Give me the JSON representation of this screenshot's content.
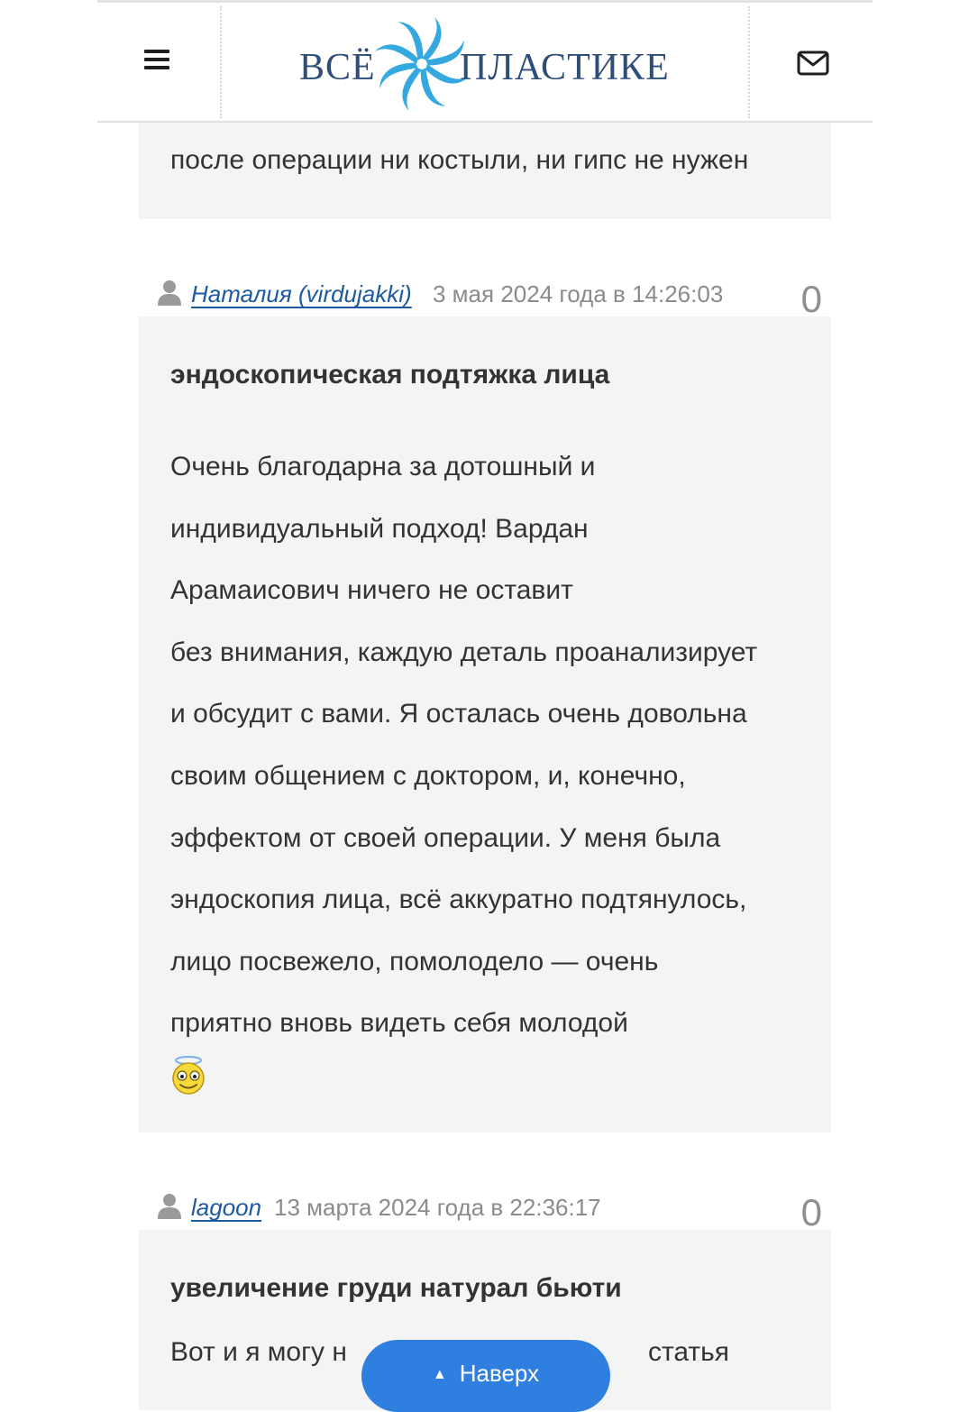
{
  "header": {
    "logo_left": "ВСЁ",
    "logo_right": "ПЛАСТИКЕ",
    "menu_icon": "hamburger-menu-icon",
    "mail_icon": "envelope-icon",
    "brand_color": "#2e4e78",
    "swirl_color": "#35a9df"
  },
  "top_card": {
    "text": "после операции ни костыли, ни гипс не нужен"
  },
  "comments": [
    {
      "author": "Наталия (virdujakki)",
      "date": "3 мая 2024 года в 14:26:03",
      "votes": "0",
      "title": "эндоскопическая подтяжка лица",
      "lines": [
        "Очень благодарна за дотошный и",
        "индивидуальный подход! Вардан",
        "Арамаисович ничего не оставит",
        "без внимания, каждую деталь проанализирует",
        "и обсудит с вами. Я осталась очень довольна",
        "своим общением с доктором, и, конечно,",
        "эффектом от своей операции. У меня была",
        "эндоскопия лица, всё аккуратно подтянулось,",
        "лицо посвежело, помолодело — очень",
        "приятно вновь видеть себя молодой"
      ],
      "emoji": "angel-smiley-icon"
    },
    {
      "author": "lagoon",
      "date": "13 марта 2024 года в 22:36:17",
      "votes": "0",
      "title": "увеличение груди натурал бьюти",
      "partial_left": "Вот и я могу н",
      "partial_right": "статья"
    }
  ],
  "scroll_top": {
    "label": "Наверх",
    "color": "#2f7fe0"
  },
  "colors": {
    "card_bg": "#f4f4f4",
    "link": "#1d5aa0",
    "meta_gray": "#8b8b8b",
    "text": "#333333"
  }
}
